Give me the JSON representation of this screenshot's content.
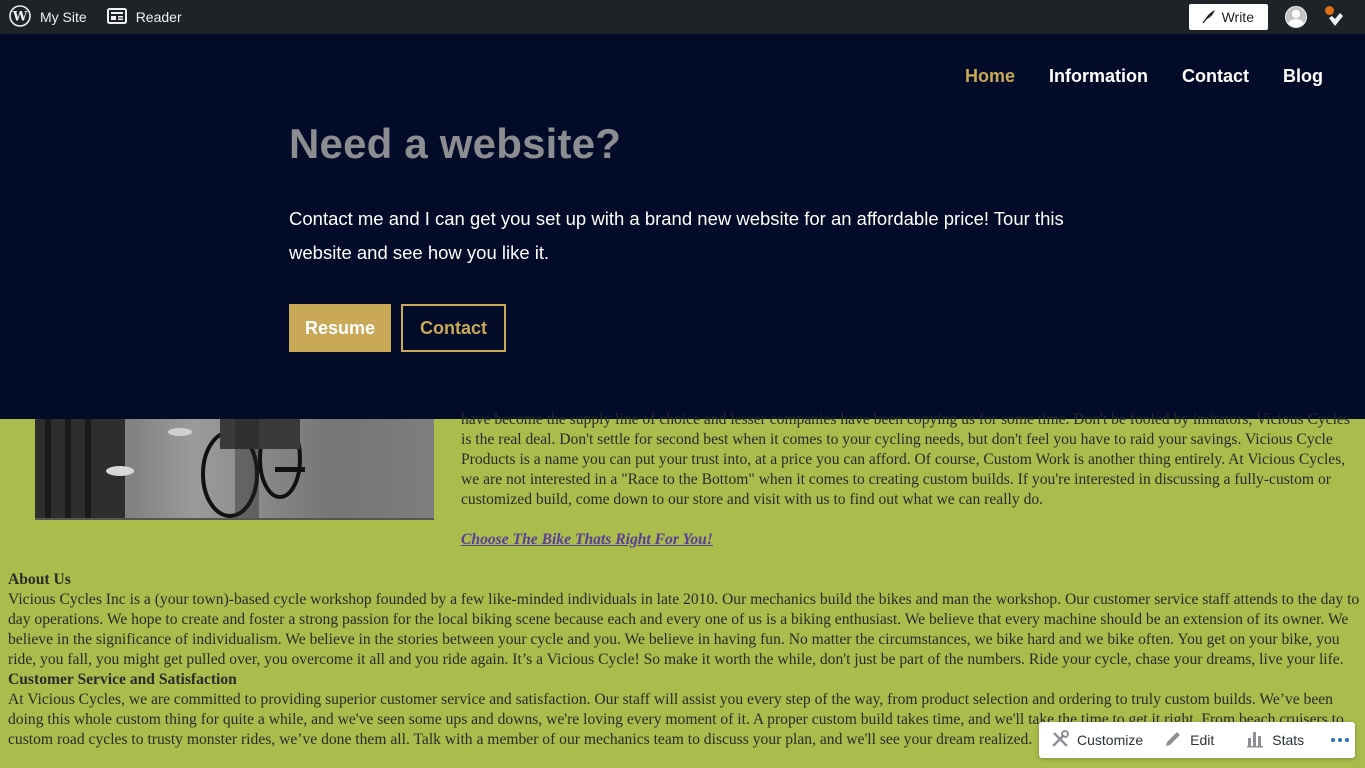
{
  "adminbar": {
    "my_site": "My Site",
    "reader": "Reader",
    "write": "Write"
  },
  "nav": {
    "items": [
      {
        "label": "Home",
        "active": true
      },
      {
        "label": "Information",
        "active": false
      },
      {
        "label": "Contact",
        "active": false
      },
      {
        "label": "Blog",
        "active": false
      }
    ]
  },
  "hero": {
    "title": "Need a website?",
    "text": "Contact me and I can get you set up with a brand new website for an affordable price! Tour this website and see how you like it.",
    "primary_button": "Resume",
    "secondary_button": "Contact"
  },
  "content": {
    "intro_partial": "have become the supply line of choice and lesser companies have been copying us for some time. Don't be fooled by imitators, Vicious Cycles is the real deal. Don't settle for second best when it comes to your cycling needs, but don't feel you have to raid your savings. Vicious Cycle Products is a name you can put your trust into, at a price you can afford. Of course, Custom Work is another thing entirely. At Vicious Cycles, we are not interested in a \"Race to the Bottom\" when it comes to creating custom builds. If you're interested in discussing a fully-custom or customized build, come down to our store and visit with us to find out what we can really do.",
    "bike_link": "Choose The Bike Thats Right For You!",
    "about_heading": "About Us",
    "about_text": "Vicious Cycles Inc is a (your town)-based cycle workshop founded by a few like-minded individuals in late 2010. Our mechanics build the bikes and man the workshop. Our customer service staff attends to the day to day operations. We hope to create and foster a strong passion for the local biking scene because each and every one of us is a biking enthusiast. We believe that every machine should be an extension of its owner. We believe in the significance of individualism. We believe in the stories between your cycle and you. We believe in having fun. No matter the circumstances, we bike hard and we bike often. You get on your bike, you ride, you fall, you might get pulled over, you overcome it all and you ride again. It’s a Vicious Cycle! So make it worth the while, don't just be part of the numbers. Ride your cycle, chase your dreams, live your life.",
    "service_heading": "Customer Service and Satisfaction",
    "service_text": "At Vicious Cycles, we are committed to providing superior customer service and satisfaction. Our staff will assist you every step of the way, from product selection and ordering to truly custom builds. We’ve been doing this whole custom thing for quite a while, and we've seen some ups and downs, we're loving every moment of it. A proper custom build takes time, and we'll take the time to get it right. From beach cruisers to custom road cycles to trusty monster rides, we’ve done them all. Talk with a member of our mechanics team to discuss your plan, and we'll see your dream realized."
  },
  "toolbar": {
    "customize": "Customize",
    "edit": "Edit",
    "stats": "Stats"
  },
  "colors": {
    "adminbar_bg": "#1d2327",
    "hero_bg": "#020c28",
    "accent_gold": "#c9a857",
    "page_bg": "#a9bc4c",
    "link_purple": "#5a3d99"
  }
}
